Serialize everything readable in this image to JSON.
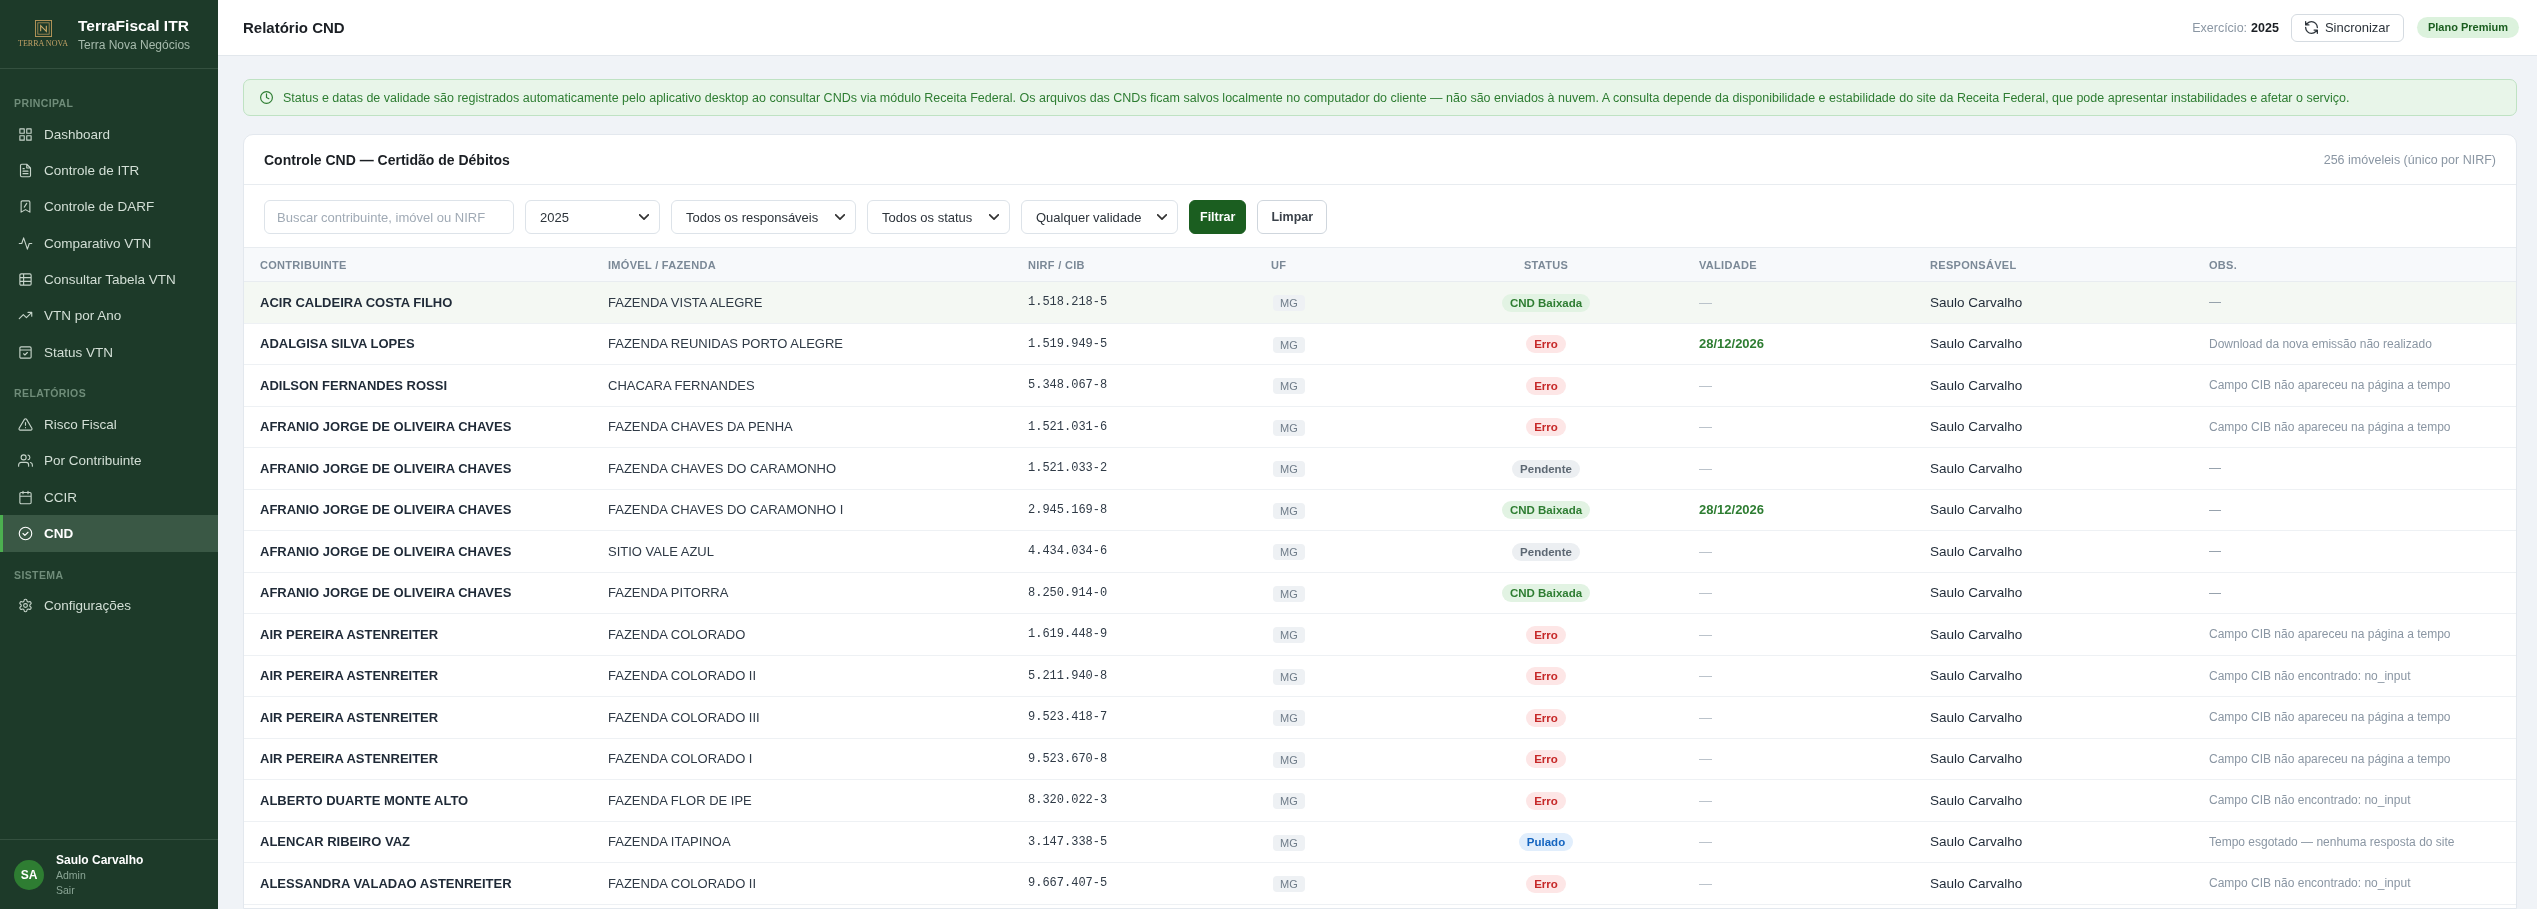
{
  "sidebar": {
    "brand": {
      "logo_text": "TERRA NOVA",
      "title": "TerraFiscal ITR",
      "subtitle": "Terra Nova Negócios"
    },
    "sections": [
      {
        "label": "PRINCIPAL",
        "items": [
          {
            "label": "Dashboard",
            "selected": false
          },
          {
            "label": "Controle de ITR",
            "selected": false
          },
          {
            "label": "Controle de DARF",
            "selected": false
          },
          {
            "label": "Comparativo VTN",
            "selected": false
          },
          {
            "label": "Consultar Tabela VTN",
            "selected": false
          },
          {
            "label": "VTN por Ano",
            "selected": false
          },
          {
            "label": "Status VTN",
            "selected": false
          }
        ]
      },
      {
        "label": "RELATÓRIOS",
        "items": [
          {
            "label": "Risco Fiscal",
            "selected": false
          },
          {
            "label": "Por Contribuinte",
            "selected": false
          },
          {
            "label": "CCIR",
            "selected": false
          },
          {
            "label": "CND",
            "selected": true
          }
        ]
      },
      {
        "label": "SISTEMA",
        "items": [
          {
            "label": "Configurações",
            "selected": false
          }
        ]
      }
    ],
    "user": {
      "initials": "SA",
      "name": "Saulo Carvalho",
      "role": "Admin",
      "logout": "Sair"
    }
  },
  "header": {
    "title": "Relatório CND",
    "exercise_label": "Exercício:",
    "exercise_value": "2025",
    "sync_button": "Sincronizar",
    "plan_badge": "Plano Premium"
  },
  "notice": {
    "text": "Status e datas de validade são registrados automaticamente pelo aplicativo desktop ao consultar CNDs via módulo Receita Federal. Os arquivos das CNDs ficam salvos localmente no computador do cliente — não são enviados à nuvem. A consulta depende da disponibilidade e estabilidade do site da Receita Federal, que pode apresentar instabilidades e afetar o serviço."
  },
  "card": {
    "title": "Controle CND — Certidão de Débitos",
    "count": "256 imóveleis (único por NIRF)",
    "filters": {
      "search": {
        "placeholder": "Buscar contribuinte, imóvel ou NIRF"
      },
      "selects": [
        "2025",
        "Todos os responsáveis",
        "Todos os status",
        "Qualquer validade"
      ],
      "buttons": [
        {
          "label": "Filtrar",
          "kind": "primary"
        },
        {
          "label": "Limpar",
          "kind": "secondary"
        }
      ]
    },
    "table": {
      "columns": [
        "CONTRIBUINTE",
        "IMÓVEL / FAZENDA",
        "NIRF / CIB",
        "UF",
        "STATUS",
        "VALIDADE",
        "RESPONSÁVEL",
        "OBS."
      ],
      "rows": [
        {
          "highlighted": true,
          "contribuinte": "ACIR CALDEIRA COSTA FILHO",
          "imovel": "FAZENDA VISTA ALEGRE",
          "nirf": "1.518.218-5",
          "uf": "MG",
          "status": {
            "label": "CND Baixada",
            "kind": "downloaded"
          },
          "validade": {
            "text": "—",
            "valid": false
          },
          "responsavel": "Saulo Carvalho",
          "obs": "—"
        },
        {
          "highlighted": false,
          "contribuinte": "ADALGISA SILVA LOPES",
          "imovel": "FAZENDA REUNIDAS PORTO ALEGRE",
          "nirf": "1.519.949-5",
          "uf": "MG",
          "status": {
            "label": "Erro",
            "kind": "error"
          },
          "validade": {
            "text": "28/12/2026",
            "valid": true
          },
          "responsavel": "Saulo Carvalho",
          "obs": "Download da nova emissão não realizado"
        },
        {
          "highlighted": false,
          "contribuinte": "ADILSON FERNANDES ROSSI",
          "imovel": "CHACARA FERNANDES",
          "nirf": "5.348.067-8",
          "uf": "MG",
          "status": {
            "label": "Erro",
            "kind": "error"
          },
          "validade": {
            "text": "—",
            "valid": false
          },
          "responsavel": "Saulo Carvalho",
          "obs": "Campo CIB não apareceu na página a tempo"
        },
        {
          "highlighted": false,
          "contribuinte": "AFRANIO JORGE DE OLIVEIRA CHAVES",
          "imovel": "FAZENDA CHAVES DA PENHA",
          "nirf": "1.521.031-6",
          "uf": "MG",
          "status": {
            "label": "Erro",
            "kind": "error"
          },
          "validade": {
            "text": "—",
            "valid": false
          },
          "responsavel": "Saulo Carvalho",
          "obs": "Campo CIB não apareceu na página a tempo"
        },
        {
          "highlighted": false,
          "contribuinte": "AFRANIO JORGE DE OLIVEIRA CHAVES",
          "imovel": "FAZENDA CHAVES DO CARAMONHO",
          "nirf": "1.521.033-2",
          "uf": "MG",
          "status": {
            "label": "Pendente",
            "kind": "pending"
          },
          "validade": {
            "text": "—",
            "valid": false
          },
          "responsavel": "Saulo Carvalho",
          "obs": "—"
        },
        {
          "highlighted": false,
          "contribuinte": "AFRANIO JORGE DE OLIVEIRA CHAVES",
          "imovel": "FAZENDA CHAVES DO CARAMONHO I",
          "nirf": "2.945.169-8",
          "uf": "MG",
          "status": {
            "label": "CND Baixada",
            "kind": "downloaded"
          },
          "validade": {
            "text": "28/12/2026",
            "valid": true
          },
          "responsavel": "Saulo Carvalho",
          "obs": "—"
        },
        {
          "highlighted": false,
          "contribuinte": "AFRANIO JORGE DE OLIVEIRA CHAVES",
          "imovel": "SITIO VALE AZUL",
          "nirf": "4.434.034-6",
          "uf": "MG",
          "status": {
            "label": "Pendente",
            "kind": "pending"
          },
          "validade": {
            "text": "—",
            "valid": false
          },
          "responsavel": "Saulo Carvalho",
          "obs": "—"
        },
        {
          "highlighted": false,
          "contribuinte": "AFRANIO JORGE DE OLIVEIRA CHAVES",
          "imovel": "FAZENDA PITORRA",
          "nirf": "8.250.914-0",
          "uf": "MG",
          "status": {
            "label": "CND Baixada",
            "kind": "downloaded"
          },
          "validade": {
            "text": "—",
            "valid": false
          },
          "responsavel": "Saulo Carvalho",
          "obs": "—"
        },
        {
          "highlighted": false,
          "contribuinte": "AIR PEREIRA ASTENREITER",
          "imovel": "FAZENDA COLORADO",
          "nirf": "1.619.448-9",
          "uf": "MG",
          "status": {
            "label": "Erro",
            "kind": "error"
          },
          "validade": {
            "text": "—",
            "valid": false
          },
          "responsavel": "Saulo Carvalho",
          "obs": "Campo CIB não apareceu na página a tempo"
        },
        {
          "highlighted": false,
          "contribuinte": "AIR PEREIRA ASTENREITER",
          "imovel": "FAZENDA COLORADO II",
          "nirf": "5.211.940-8",
          "uf": "MG",
          "status": {
            "label": "Erro",
            "kind": "error"
          },
          "validade": {
            "text": "—",
            "valid": false
          },
          "responsavel": "Saulo Carvalho",
          "obs": "Campo CIB não encontrado: no_input"
        },
        {
          "highlighted": false,
          "contribuinte": "AIR PEREIRA ASTENREITER",
          "imovel": "FAZENDA COLORADO III",
          "nirf": "9.523.418-7",
          "uf": "MG",
          "status": {
            "label": "Erro",
            "kind": "error"
          },
          "validade": {
            "text": "—",
            "valid": false
          },
          "responsavel": "Saulo Carvalho",
          "obs": "Campo CIB não apareceu na página a tempo"
        },
        {
          "highlighted": false,
          "contribuinte": "AIR PEREIRA ASTENREITER",
          "imovel": "FAZENDA COLORADO I",
          "nirf": "9.523.670-8",
          "uf": "MG",
          "status": {
            "label": "Erro",
            "kind": "error"
          },
          "validade": {
            "text": "—",
            "valid": false
          },
          "responsavel": "Saulo Carvalho",
          "obs": "Campo CIB não apareceu na página a tempo"
        },
        {
          "highlighted": false,
          "contribuinte": "ALBERTO DUARTE MONTE ALTO",
          "imovel": "FAZENDA FLOR DE IPE",
          "nirf": "8.320.022-3",
          "uf": "MG",
          "status": {
            "label": "Erro",
            "kind": "error"
          },
          "validade": {
            "text": "—",
            "valid": false
          },
          "responsavel": "Saulo Carvalho",
          "obs": "Campo CIB não encontrado: no_input"
        },
        {
          "highlighted": false,
          "contribuinte": "ALENCAR RIBEIRO VAZ",
          "imovel": "FAZENDA ITAPINOA",
          "nirf": "3.147.338-5",
          "uf": "MG",
          "status": {
            "label": "Pulado",
            "kind": "skipped"
          },
          "validade": {
            "text": "—",
            "valid": false
          },
          "responsavel": "Saulo Carvalho",
          "obs": "Tempo esgotado — nenhuma resposta do site"
        },
        {
          "highlighted": false,
          "contribuinte": "ALESSANDRA VALADAO ASTENREITER",
          "imovel": "FAZENDA COLORADO II",
          "nirf": "9.667.407-5",
          "uf": "MG",
          "status": {
            "label": "Erro",
            "kind": "error"
          },
          "validade": {
            "text": "—",
            "valid": false
          },
          "responsavel": "Saulo Carvalho",
          "obs": "Campo CIB não encontrado: no_input"
        }
      ]
    }
  }
}
